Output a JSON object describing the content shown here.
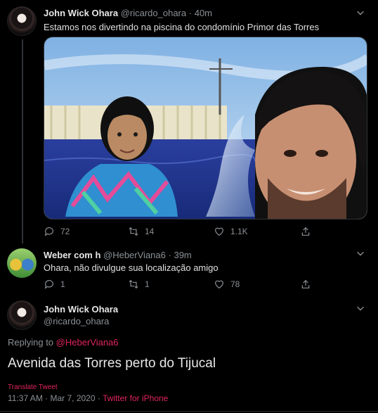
{
  "tweet1": {
    "name": "John Wick Ohara",
    "handle": "@ricardo_ohara",
    "time": "40m",
    "text": "Estamos nos divertindo na piscina do condomínio Primor das Torres",
    "replies": "72",
    "retweets": "14",
    "likes": "1.1K"
  },
  "tweet2": {
    "name": "Weber com h",
    "handle": "@HeberViana6",
    "time": "39m",
    "text": "Ohara, não divulgue sua localização amigo",
    "replies": "1",
    "retweets": "1",
    "likes": "78"
  },
  "tweet3": {
    "name": "John Wick Ohara",
    "handle": "@ricardo_ohara",
    "replying_prefix": "Replying to",
    "replying_to": "@HeberViana6",
    "text": "Avenida das Torres perto do Tijucal",
    "translate": "Translate Tweet",
    "timestamp": "11:37 AM · Mar 7, 2020 ·",
    "source": "Twitter for iPhone"
  },
  "separator": "·",
  "icons": [
    "reply-icon",
    "retweet-icon",
    "like-icon",
    "share-icon",
    "chevron-down-icon"
  ],
  "colors": {
    "background": "#000000",
    "accent": "#e0245e",
    "muted": "#8a8f94"
  }
}
